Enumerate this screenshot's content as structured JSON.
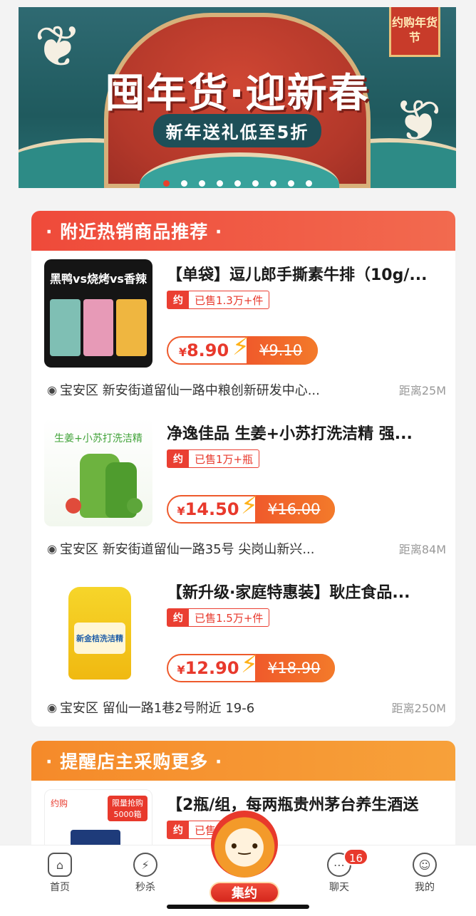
{
  "banner": {
    "title": "囤年货·迎新春",
    "subtitle": "新年送礼低至5折",
    "tag": "约购年货节",
    "active_dot": 0,
    "dot_count": 9
  },
  "section1": {
    "title": "· 附近热销商品推荐 ·",
    "items": [
      {
        "name": "【单袋】逗儿郎手撕素牛排（10g/...",
        "thumb_label": "黑鸭vs烧烤vs香辣",
        "sold_icon": "约",
        "sold": "已售1.3万+件",
        "price_symbol": "¥",
        "price": "8.90",
        "old_price": "¥9.10",
        "address": "宝安区 新安街道留仙一路中粮创新研发中心...",
        "distance": "距离25M"
      },
      {
        "name": "净逸佳品 生姜+小苏打洗洁精 强...",
        "thumb_label": "生姜+小苏打洗洁精",
        "sold_icon": "约",
        "sold": "已售1万+瓶",
        "price_symbol": "¥",
        "price": "14.50",
        "old_price": "¥16.00",
        "address": "宝安区 新安街道留仙一路35号 尖岗山新兴...",
        "distance": "距离84M"
      },
      {
        "name": "【新升级·家庭特惠装】耿庄食品...",
        "thumb_label": "新金桔洗洁精",
        "sold_icon": "约",
        "sold": "已售1.5万+件",
        "price_symbol": "¥",
        "price": "12.90",
        "old_price": "¥18.90",
        "address": "宝安区 留仙一路1巷2号附近  19-6",
        "distance": "距离250M"
      }
    ]
  },
  "section2": {
    "title": "· 提醒店主采购更多 ·",
    "items": [
      {
        "name": "【2瓶/组，每两瓶贵州茅台养生酒送",
        "thumb_label": "约购",
        "thumb_badge": "限量抢购 5000箱",
        "sold_icon": "约",
        "sold": "已售"
      }
    ]
  },
  "tabbar": {
    "home": "首页",
    "flash": "秒杀",
    "center": "集约",
    "chat": "聊天",
    "chat_badge": "16",
    "mine": "我的"
  },
  "colors": {
    "accent": "#e8392c",
    "orange": "#f37a2a",
    "banner_bg": "#2f6a72"
  }
}
